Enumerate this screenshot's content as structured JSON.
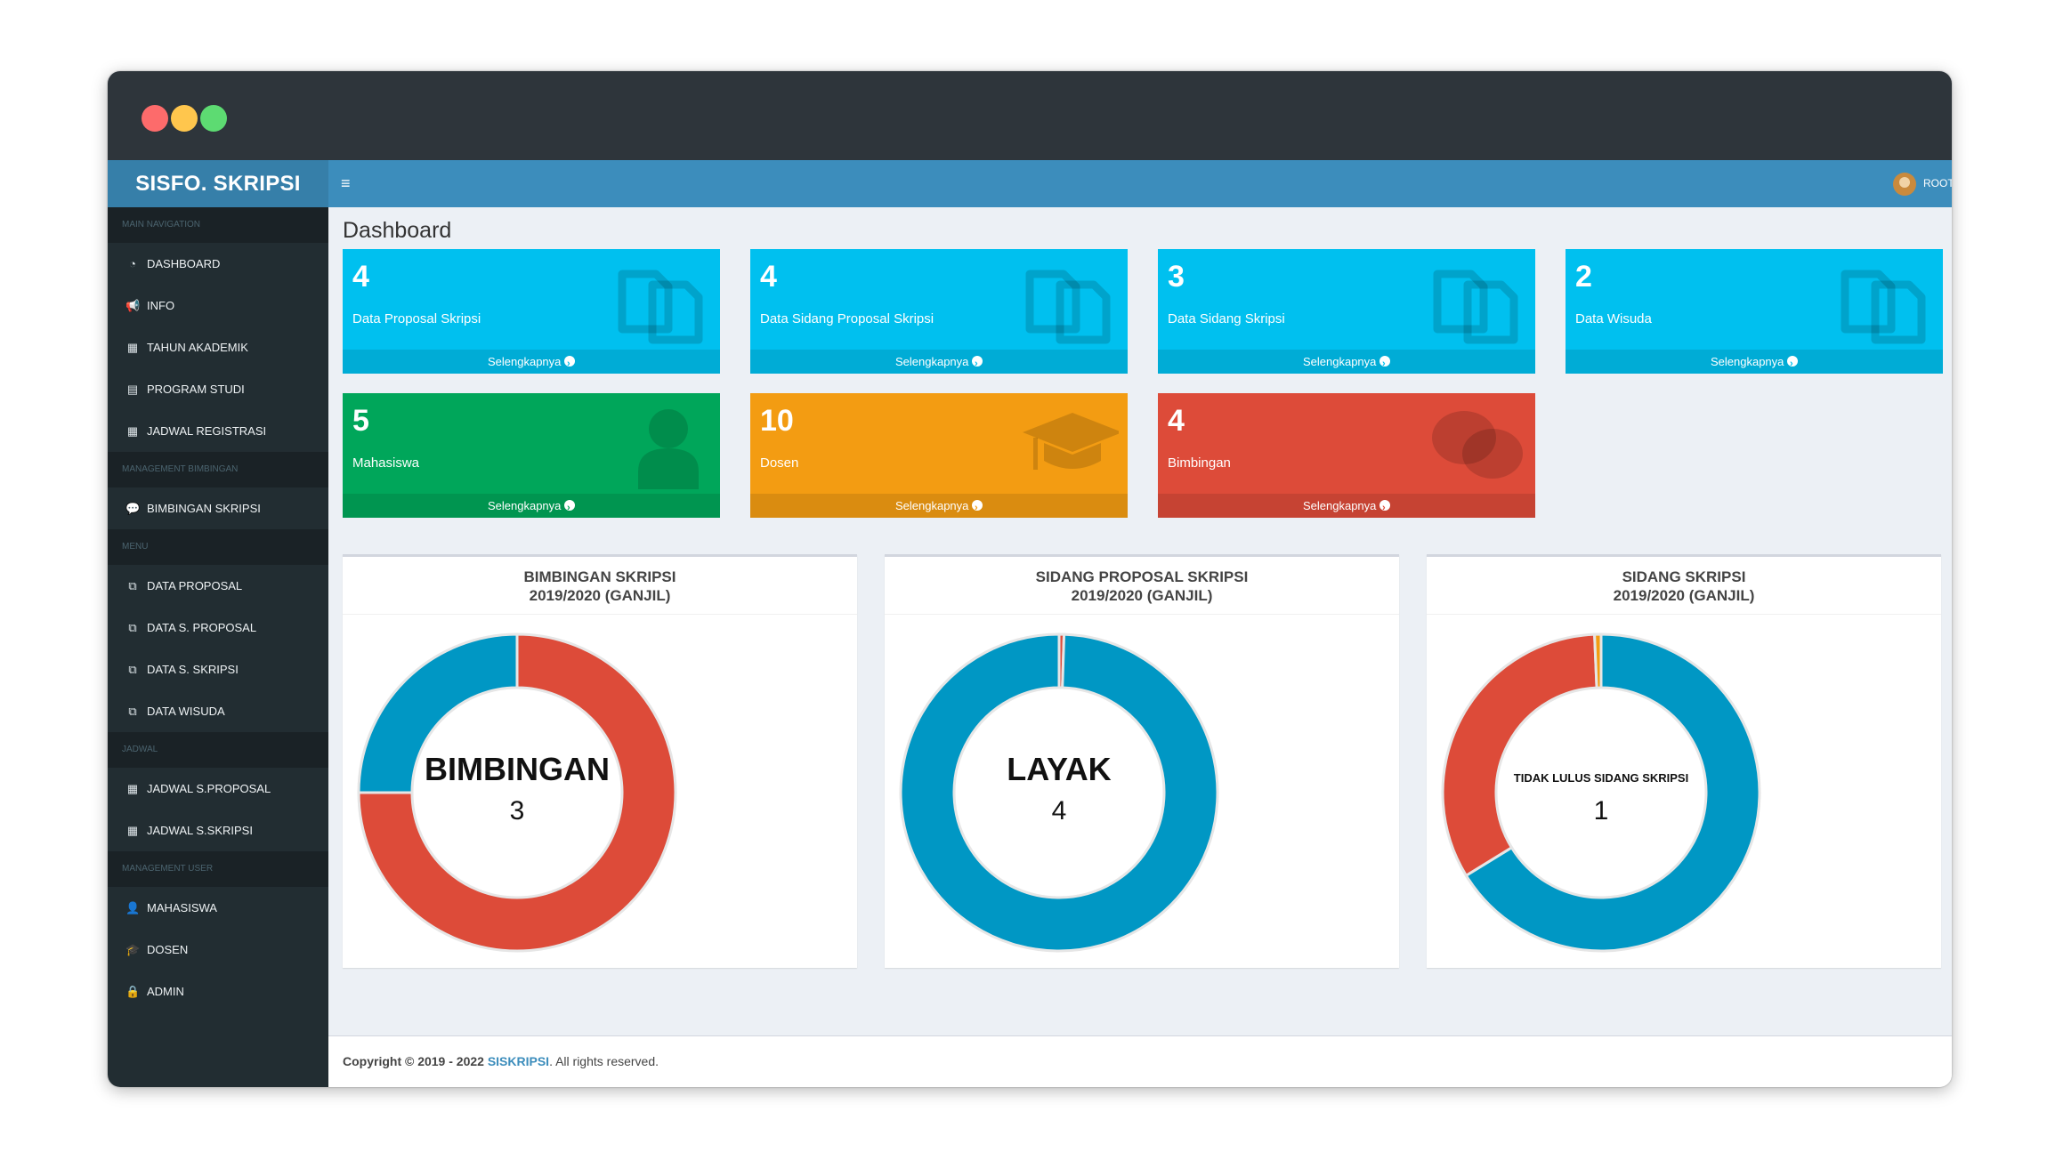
{
  "window": {
    "dots": [
      "#fd6b6b",
      "#ffc64d",
      "#5ddb72"
    ]
  },
  "sidebar": {
    "brand": "SISFO. SKRIPSI",
    "sections": [
      {
        "type": "header",
        "label": "MAIN NAVIGATION"
      },
      {
        "type": "item",
        "label": "DASHBOARD",
        "icon": "dashboard-icon",
        "glyph": "◔"
      },
      {
        "type": "item",
        "label": "INFO",
        "icon": "bullhorn-icon",
        "glyph": "📢"
      },
      {
        "type": "item",
        "label": "TAHUN AKADEMIK",
        "icon": "calendar-icon",
        "glyph": "▦"
      },
      {
        "type": "item",
        "label": "PROGRAM STUDI",
        "icon": "list-icon",
        "glyph": "▤"
      },
      {
        "type": "item",
        "label": "JADWAL REGISTRASI",
        "icon": "calendar-plus-icon",
        "glyph": "▦"
      },
      {
        "type": "header",
        "label": "MANAGEMENT BIMBINGAN"
      },
      {
        "type": "item",
        "label": "BIMBINGAN SKRIPSI",
        "icon": "comments-icon",
        "glyph": "💬"
      },
      {
        "type": "header",
        "label": "MENU"
      },
      {
        "type": "item",
        "label": "DATA PROPOSAL",
        "icon": "copy-icon",
        "glyph": "⧉"
      },
      {
        "type": "item",
        "label": "DATA S. PROPOSAL",
        "icon": "copy-icon",
        "glyph": "⧉"
      },
      {
        "type": "item",
        "label": "DATA S. SKRIPSI",
        "icon": "copy-icon",
        "glyph": "⧉"
      },
      {
        "type": "item",
        "label": "DATA WISUDA",
        "icon": "copy-icon",
        "glyph": "⧉"
      },
      {
        "type": "header",
        "label": "JADWAL"
      },
      {
        "type": "item",
        "label": "JADWAL S.PROPOSAL",
        "icon": "calendar-icon",
        "glyph": "▦"
      },
      {
        "type": "item",
        "label": "JADWAL S.SKRIPSI",
        "icon": "calendar-icon",
        "glyph": "▦"
      },
      {
        "type": "header",
        "label": "MANAGEMENT USER"
      },
      {
        "type": "item",
        "label": "MAHASISWA",
        "icon": "user-icon",
        "glyph": "👤"
      },
      {
        "type": "item",
        "label": "DOSEN",
        "icon": "graduation-cap-icon",
        "glyph": "🎓"
      },
      {
        "type": "item",
        "label": "ADMIN",
        "icon": "user-lock-icon",
        "glyph": "🔒"
      }
    ]
  },
  "topbar": {
    "menu_icon": "≡",
    "user": "ROOT"
  },
  "page": {
    "title": "Dashboard"
  },
  "stats": [
    {
      "value": "4",
      "label": "Data Proposal Skripsi",
      "footer": "Selengkapnya",
      "color": "#00c0ef",
      "icon": "copy-icon"
    },
    {
      "value": "4",
      "label": "Data Sidang Proposal Skripsi",
      "footer": "Selengkapnya",
      "color": "#00c0ef",
      "icon": "copy-icon"
    },
    {
      "value": "3",
      "label": "Data Sidang Skripsi",
      "footer": "Selengkapnya",
      "color": "#00c0ef",
      "icon": "copy-icon"
    },
    {
      "value": "2",
      "label": "Data Wisuda",
      "footer": "Selengkapnya",
      "color": "#00c0ef",
      "icon": "copy-icon"
    },
    {
      "value": "5",
      "label": "Mahasiswa",
      "footer": "Selengkapnya",
      "color": "#00a65a",
      "icon": "user-icon"
    },
    {
      "value": "10",
      "label": "Dosen",
      "footer": "Selengkapnya",
      "color": "#f39c12",
      "icon": "graduation-cap-icon"
    },
    {
      "value": "4",
      "label": "Bimbingan",
      "footer": "Selengkapnya",
      "color": "#dd4b39",
      "icon": "comments-icon"
    }
  ],
  "chart_data": [
    {
      "type": "pie",
      "title": [
        "BIMBINGAN SKRIPSI",
        "2019/2020 (GANJIL)"
      ],
      "center_label": "BIMBINGAN",
      "center_value": "3",
      "slices": [
        {
          "value": 3,
          "color": "#dd4b39"
        },
        {
          "value": 1,
          "color": "#0097c4"
        }
      ]
    },
    {
      "type": "pie",
      "title": [
        "SIDANG PROPOSAL SKRIPSI",
        "2019/2020 (GANJIL)"
      ],
      "center_label": "LAYAK",
      "center_value": "4",
      "slices": [
        {
          "value": 0.02,
          "color": "#dd4b39"
        },
        {
          "value": 4,
          "color": "#0097c4"
        }
      ]
    },
    {
      "type": "pie",
      "title": [
        "SIDANG SKRIPSI",
        "2019/2020 (GANJIL)"
      ],
      "center_label": "TIDAK LULUS SIDANG SKRIPSI",
      "center_value": "1",
      "slices": [
        {
          "value": 2,
          "color": "#0097c4"
        },
        {
          "value": 1,
          "color": "#dd4b39"
        },
        {
          "value": 0.02,
          "color": "#f39c12"
        }
      ]
    }
  ],
  "footer": {
    "prefix": "Copyright © 2019 - 2022 ",
    "brand": "SISKRIPSI",
    "suffix": ". All rights reserved."
  }
}
